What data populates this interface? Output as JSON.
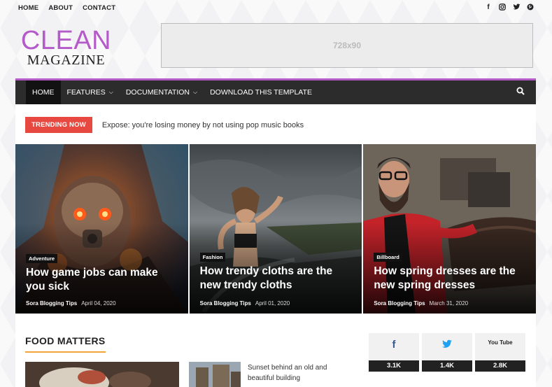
{
  "topnav": {
    "items": [
      "HOME",
      "ABOUT",
      "CONTACT"
    ]
  },
  "social_icons": [
    "facebook-icon",
    "instagram-icon",
    "twitter-icon",
    "pinterest-icon"
  ],
  "logo": {
    "line1": "CLEAN",
    "line2": "MAGAZINE"
  },
  "ad": {
    "label": "728x90"
  },
  "mainnav": {
    "items": [
      {
        "label": "HOME",
        "active": true
      },
      {
        "label": "FEATURES",
        "dropdown": true
      },
      {
        "label": "DOCUMENTATION",
        "dropdown": true
      },
      {
        "label": "DOWNLOAD THIS TEMPLATE"
      }
    ]
  },
  "trending": {
    "tag": "TRENDING NOW",
    "text": "Expose: you're losing money by not using pop music books"
  },
  "featured": [
    {
      "label": "Adventure",
      "title": "How game jobs can make you sick",
      "author": "Sora Blogging Tips",
      "date": "April 04, 2020"
    },
    {
      "label": "Fashion",
      "title": "How trendy cloths are the new trendy cloths",
      "author": "Sora Blogging Tips",
      "date": "April 01, 2020"
    },
    {
      "label": "Billboard",
      "title": "How spring dresses are the new spring dresses",
      "author": "Sora Blogging Tips",
      "date": "March 31, 2020"
    }
  ],
  "section": {
    "title": "FOOD MATTERS"
  },
  "posts": [
    {
      "title": "Sunset behind an old and beautiful building"
    }
  ],
  "counters": [
    {
      "icon": "facebook-icon",
      "glyph": "f",
      "count": "3.1K",
      "color": "#3b5998"
    },
    {
      "icon": "twitter-icon",
      "glyph": "t",
      "count": "1.4K",
      "color": "#1da1f2"
    },
    {
      "icon": "youtube-icon",
      "glyph": "You Tube",
      "count": "2.8K",
      "color": "#222222"
    }
  ],
  "colors": {
    "accent": "#b45ac9",
    "trending": "#e7483f",
    "section_underline": "#f0a43a",
    "nav": "#2c2c2c"
  }
}
